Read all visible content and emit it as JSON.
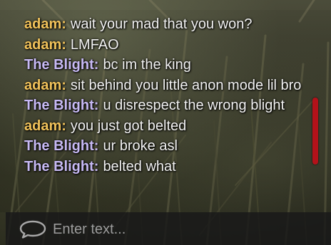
{
  "colors": {
    "author_adam": "#f1c25a",
    "author_blight": "#c7b9f4",
    "message_text": "#f2f2f2",
    "scrollbar_thumb": "#b3121a",
    "input_background": "#181818"
  },
  "chat": {
    "messages": [
      {
        "author": "adam:",
        "author_color": "#f1c25a",
        "text": "wait your mad that you won?"
      },
      {
        "author": "adam:",
        "author_color": "#f1c25a",
        "text": "LMFAO"
      },
      {
        "author": "The Blight:",
        "author_color": "#c7b9f4",
        "text": "bc im the king"
      },
      {
        "author": "adam:",
        "author_color": "#f1c25a",
        "text": "sit behind you little anon mode lil bro"
      },
      {
        "author": "The Blight:",
        "author_color": "#c7b9f4",
        "text": "u disrespect the wrong blight"
      },
      {
        "author": "adam:",
        "author_color": "#f1c25a",
        "text": "you just got belted"
      },
      {
        "author": "The Blight:",
        "author_color": "#c7b9f4",
        "text": "ur broke asl"
      },
      {
        "author": "The Blight:",
        "author_color": "#c7b9f4",
        "text": "belted what"
      }
    ]
  },
  "input": {
    "placeholder": "Enter text...",
    "value": "",
    "icon": "speech-bubble-icon"
  }
}
